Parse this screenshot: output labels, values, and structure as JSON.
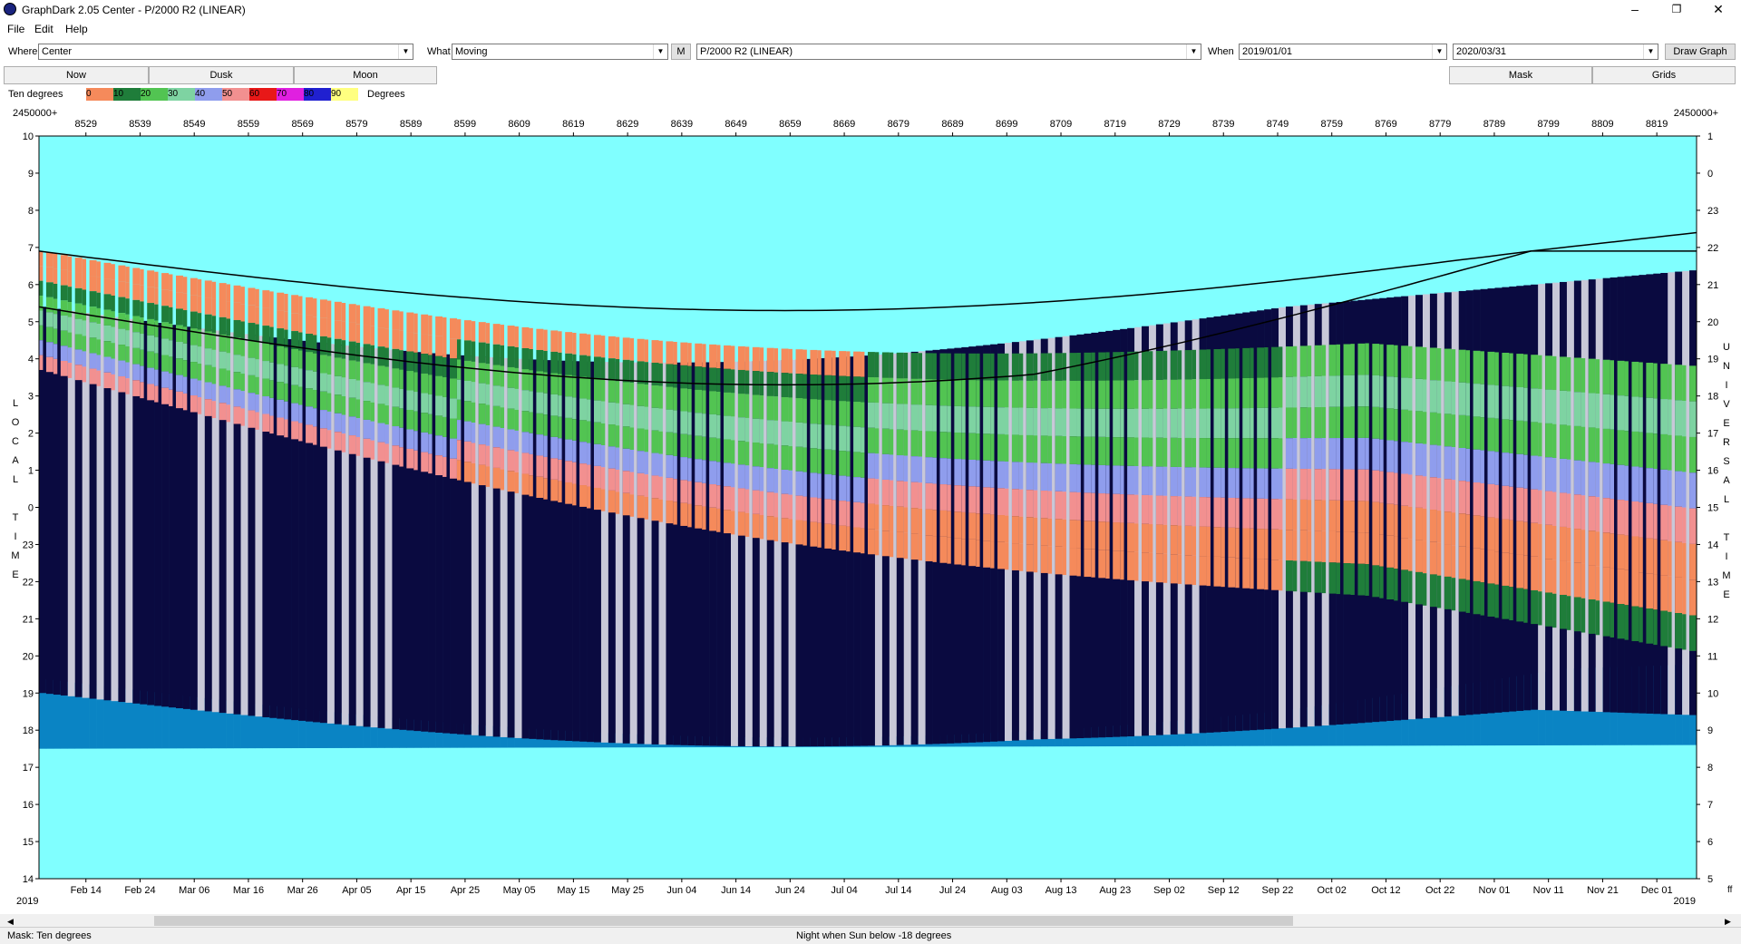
{
  "window": {
    "title": "GraphDark 2.05  Center  -  P/2000 R2 (LINEAR)",
    "minimize": "–",
    "restore": "❐",
    "close": "✕"
  },
  "menu": [
    "File",
    "Edit",
    "Help"
  ],
  "toolbar": {
    "where_label": "Where",
    "where_value": "Center",
    "what_label": "What",
    "what_value": "Moving",
    "m_button": "M",
    "object_value": "P/2000 R2 (LINEAR)",
    "when_label": "When",
    "when_start": "2019/01/01",
    "when_end": "2020/03/31",
    "draw_button": "Draw Graph"
  },
  "tabs": {
    "now": "Now",
    "dusk": "Dusk",
    "moon": "Moon",
    "mask": "Mask",
    "grids": "Grids"
  },
  "legend": {
    "label": "Ten degrees",
    "steps": [
      "0",
      "10",
      "20",
      "30",
      "40",
      "50",
      "60",
      "70",
      "80",
      "90"
    ],
    "colors": [
      "#f58a5b",
      "#1f7d3a",
      "#52c452",
      "#7ed3a2",
      "#8f9ded",
      "#f29090",
      "#e81818",
      "#e020e0",
      "#2020d0",
      "#ffff80"
    ],
    "unit": "Degrees"
  },
  "chart_data": {
    "type": "heatmap",
    "jd_prefix_left": "2450000+",
    "jd_prefix_right": "2450000+",
    "jd_ticks": [
      "8529",
      "8539",
      "8549",
      "8559",
      "8569",
      "8579",
      "8589",
      "8599",
      "8609",
      "8619",
      "8629",
      "8639",
      "8649",
      "8659",
      "8669",
      "8679",
      "8689",
      "8699",
      "8709",
      "8719",
      "8729",
      "8739",
      "8749",
      "8759",
      "8769",
      "8779",
      "8789",
      "8799",
      "8809",
      "8819"
    ],
    "date_ticks": [
      "Feb 14",
      "Feb 24",
      "Mar 06",
      "Mar 16",
      "Mar 26",
      "Apr 05",
      "Apr 15",
      "Apr 25",
      "May 05",
      "May 15",
      "May 25",
      "Jun 04",
      "Jun 14",
      "Jun 24",
      "Jul 04",
      "Jul 14",
      "Jul 24",
      "Aug 03",
      "Aug 13",
      "Aug 23",
      "Sep 02",
      "Sep 12",
      "Sep 22",
      "Oct 02",
      "Oct 12",
      "Oct 22",
      "Nov 01",
      "Nov 11",
      "Nov 21",
      "Dec 01"
    ],
    "year_left": "2019",
    "year_right": "2019",
    "right_edge_label": "ff",
    "left_axis_title": [
      "L",
      "O",
      "C",
      "A",
      "L",
      "",
      "T",
      "I",
      "M",
      "E"
    ],
    "right_axis_title": [
      "U",
      "N",
      "I",
      "V",
      "E",
      "R",
      "S",
      "A",
      "L",
      "",
      "T",
      "I",
      "M",
      "E"
    ],
    "left_ticks": [
      "10",
      "9",
      "8",
      "7",
      "6",
      "5",
      "4",
      "3",
      "2",
      "1",
      "0",
      "23",
      "22",
      "21",
      "20",
      "19",
      "18",
      "17",
      "16",
      "15",
      "14"
    ],
    "right_ticks": [
      "1",
      "0",
      "23",
      "22",
      "21",
      "20",
      "19",
      "18",
      "17",
      "16",
      "15",
      "14",
      "13",
      "12",
      "11",
      "10",
      "9",
      "8",
      "7",
      "6",
      "5"
    ],
    "colors": {
      "day": "#80ffff",
      "twilight": "#0a84c4",
      "night": "#0a0a40",
      "moon": "#c8c8d8",
      "curve": "#000000"
    }
  },
  "status": {
    "mask": "Mask:  Ten degrees",
    "night": "Night when Sun below -18 degrees"
  }
}
